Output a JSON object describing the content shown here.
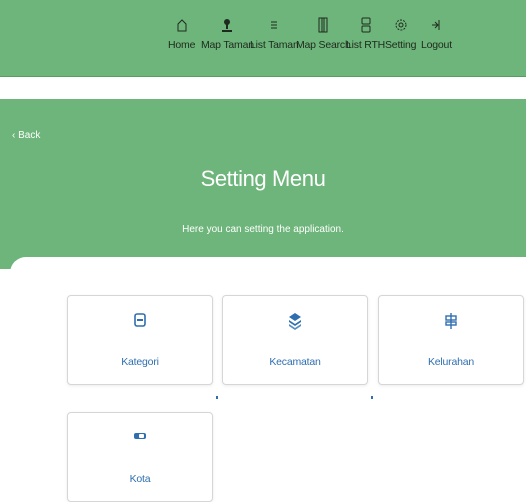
{
  "nav": {
    "items": [
      {
        "label": "Home",
        "icon": "home-icon"
      },
      {
        "label": "Map Taman",
        "icon": "map-pin-icon"
      },
      {
        "label": "List Taman",
        "icon": "list-icon"
      },
      {
        "label": "Map Search",
        "icon": "map-icon"
      },
      {
        "label": "List RTH",
        "icon": "layout-icon"
      },
      {
        "label": "Setting",
        "icon": "gear-icon"
      },
      {
        "label": "Logout",
        "icon": "logout-icon"
      }
    ]
  },
  "hero": {
    "back_label": "‹ Back",
    "title": "Setting Menu",
    "subtitle": "Here you can setting the application."
  },
  "cards": [
    {
      "label": "Kategori",
      "icon": "category-icon"
    },
    {
      "label": "Kecamatan",
      "icon": "layers-icon"
    },
    {
      "label": "Kelurahan",
      "icon": "signpost-icon"
    },
    {
      "label": "Kota",
      "icon": "toggle-icon"
    }
  ],
  "colors": {
    "header_green": "#6db57a",
    "link_blue": "#2f6fb0",
    "nav_text": "#1f2a1f"
  }
}
